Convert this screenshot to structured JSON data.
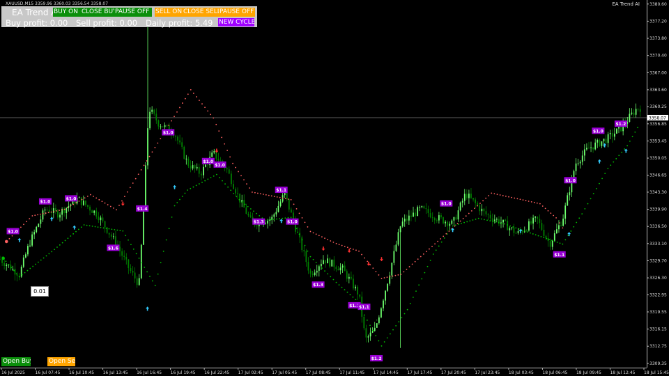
{
  "symbol_info": "XAUUSD,M15  3359.96 3360.03 3356.54 3358.07",
  "ea_title": "EA Trend AI",
  "panel": {
    "title": "EA Trend A",
    "buy_on_label": "BUY ON",
    "close_buy_label": "CLOSE BUY",
    "pause_buy_label": "PAUSE OFF",
    "sell_on_label": "SELL ON",
    "close_sell_label": "CLOSE SELL",
    "pause_sell_label": "PAUSE OFF",
    "buy_profit": "Buy profit: 0.00",
    "sell_profit": "Sell profit: 0.00",
    "daily_profit": "Daily profit: 5.49",
    "new_cycle_label": "NEW CYCLE"
  },
  "lot_value": "0.01",
  "open_buy_label": "Open Buy",
  "open_sell_label": "Open Sell",
  "current_price": "3358.07",
  "colors": {
    "bull": "#6dff6d",
    "bear": "#008000",
    "buy_button": "#0b8f0b",
    "sell_button": "#ffa500",
    "profit_label": "#9a00d6",
    "trail_dots": "#00c000",
    "resistance_dots": "#ff6060"
  },
  "chart_data": {
    "type": "candlestick",
    "price_ticks": [
      "3380.60",
      "3377.20",
      "3373.80",
      "3370.40",
      "3367.00",
      "3363.60",
      "3360.25",
      "3356.85",
      "3353.45",
      "3350.05",
      "3346.65",
      "3343.30",
      "3339.90",
      "3336.50",
      "3333.10",
      "3329.70",
      "3326.30",
      "3322.95",
      "3319.55",
      "3316.15",
      "3312.75",
      "3309.35"
    ],
    "time_ticks": [
      "16 Jul 2025",
      "16 Jul 07:45",
      "16 Jul 10:45",
      "16 Jul 13:45",
      "16 Jul 16:45",
      "16 Jul 19:45",
      "16 Jul 22:45",
      "17 Jul 02:45",
      "17 Jul 05:45",
      "17 Jul 08:45",
      "17 Jul 11:45",
      "17 Jul 14:45",
      "17 Jul 17:45",
      "17 Jul 20:45",
      "17 Jul 23:45",
      "18 Jul 03:45",
      "18 Jul 06:45",
      "18 Jul 09:45",
      "18 Jul 12:45",
      "18 Jul 15:45"
    ],
    "ylim": [
      3308.5,
      3381.4
    ],
    "profit_labels": [
      {
        "text": "$1.0",
        "t": 0.02,
        "price": 3335.5
      },
      {
        "text": "$1.0",
        "t": 0.07,
        "price": 3341.4
      },
      {
        "text": "$1.0",
        "t": 0.11,
        "price": 3342.0
      },
      {
        "text": "$1.4",
        "t": 0.22,
        "price": 3340.0
      },
      {
        "text": "$1.6",
        "t": 0.175,
        "price": 3332.2
      },
      {
        "text": "$1.0",
        "t": 0.26,
        "price": 3355.1
      },
      {
        "text": "$1.0",
        "t": 0.322,
        "price": 3349.4
      },
      {
        "text": "$1.0",
        "t": 0.34,
        "price": 3348.7
      },
      {
        "text": "$1.3",
        "t": 0.4,
        "price": 3337.4
      },
      {
        "text": "$1.1",
        "t": 0.435,
        "price": 3343.7
      },
      {
        "text": "$1.0",
        "t": 0.452,
        "price": 3337.4
      },
      {
        "text": "$1.3",
        "t": 0.492,
        "price": 3324.9
      },
      {
        "text": "$1.1",
        "t": 0.548,
        "price": 3320.8
      },
      {
        "text": "$1.1",
        "t": 0.563,
        "price": 3320.5
      },
      {
        "text": "$1.2",
        "t": 0.582,
        "price": 3310.3
      },
      {
        "text": "$1.0",
        "t": 0.69,
        "price": 3341.0
      },
      {
        "text": "$1.1",
        "t": 0.865,
        "price": 3330.9
      },
      {
        "text": "$1.0",
        "t": 0.882,
        "price": 3345.6
      },
      {
        "text": "$1.0",
        "t": 0.925,
        "price": 3355.4
      },
      {
        "text": "$1.2",
        "t": 0.96,
        "price": 3356.8
      }
    ],
    "buy_arrows": [
      {
        "t": 0.03,
        "price": 3333.8
      },
      {
        "t": 0.08,
        "price": 3338.0
      },
      {
        "t": 0.115,
        "price": 3336.3
      },
      {
        "t": 0.228,
        "price": 3320.2
      },
      {
        "t": 0.27,
        "price": 3344.3
      },
      {
        "t": 0.435,
        "price": 3337.6
      },
      {
        "t": 0.7,
        "price": 3335.8
      },
      {
        "t": 0.805,
        "price": 3335.6
      },
      {
        "t": 0.88,
        "price": 3335.0
      },
      {
        "t": 0.927,
        "price": 3349.4
      },
      {
        "t": 0.935,
        "price": 3352.6
      },
      {
        "t": 0.968,
        "price": 3351.5
      }
    ],
    "sell_arrows": [
      {
        "t": 0.19,
        "price": 3341.0
      },
      {
        "t": 0.335,
        "price": 3351.5
      },
      {
        "t": 0.5,
        "price": 3332.1
      },
      {
        "t": 0.54,
        "price": 3331.7
      },
      {
        "t": 0.57,
        "price": 3329.1
      },
      {
        "t": 0.59,
        "price": 3330.0
      }
    ],
    "trail_support": [
      {
        "t": 0.005,
        "price": 3330.2
      },
      {
        "t": 0.03,
        "price": 3326.5
      },
      {
        "t": 0.08,
        "price": 3331.5
      },
      {
        "t": 0.13,
        "price": 3336.8
      },
      {
        "t": 0.19,
        "price": 3335.6
      },
      {
        "t": 0.24,
        "price": 3324.8
      },
      {
        "t": 0.27,
        "price": 3340.6
      },
      {
        "t": 0.29,
        "price": 3343.7
      },
      {
        "t": 0.335,
        "price": 3346.8
      },
      {
        "t": 0.37,
        "price": 3341.8
      },
      {
        "t": 0.41,
        "price": 3337.7
      },
      {
        "t": 0.45,
        "price": 3338.3
      },
      {
        "t": 0.48,
        "price": 3330.5
      },
      {
        "t": 0.52,
        "price": 3325.4
      },
      {
        "t": 0.55,
        "price": 3322.0
      },
      {
        "t": 0.59,
        "price": 3312.8
      },
      {
        "t": 0.63,
        "price": 3320.0
      },
      {
        "t": 0.67,
        "price": 3331.0
      },
      {
        "t": 0.7,
        "price": 3336.6
      },
      {
        "t": 0.74,
        "price": 3338.1
      },
      {
        "t": 0.78,
        "price": 3337.0
      },
      {
        "t": 0.82,
        "price": 3335.2
      },
      {
        "t": 0.87,
        "price": 3333.0
      },
      {
        "t": 0.9,
        "price": 3339.0
      },
      {
        "t": 0.94,
        "price": 3348.0
      },
      {
        "t": 0.97,
        "price": 3352.5
      },
      {
        "t": 0.99,
        "price": 3357.0
      }
    ],
    "trail_resistance": [
      {
        "t": 0.01,
        "price": 3333.5
      },
      {
        "t": 0.05,
        "price": 3338.6
      },
      {
        "t": 0.1,
        "price": 3339.9
      },
      {
        "t": 0.14,
        "price": 3342.8
      },
      {
        "t": 0.18,
        "price": 3339.8
      },
      {
        "t": 0.295,
        "price": 3363.6
      },
      {
        "t": 0.33,
        "price": 3358.0
      },
      {
        "t": 0.36,
        "price": 3349.0
      },
      {
        "t": 0.39,
        "price": 3343.3
      },
      {
        "t": 0.45,
        "price": 3341.8
      },
      {
        "t": 0.48,
        "price": 3335.5
      },
      {
        "t": 0.52,
        "price": 3333.1
      },
      {
        "t": 0.555,
        "price": 3331.6
      },
      {
        "t": 0.59,
        "price": 3326.2
      },
      {
        "t": 0.62,
        "price": 3327.0
      },
      {
        "t": 0.76,
        "price": 3343.1
      },
      {
        "t": 0.8,
        "price": 3342.0
      },
      {
        "t": 0.835,
        "price": 3341.0
      },
      {
        "t": 0.86,
        "price": 3338.2
      },
      {
        "t": 0.875,
        "price": 3335.2
      }
    ]
  }
}
